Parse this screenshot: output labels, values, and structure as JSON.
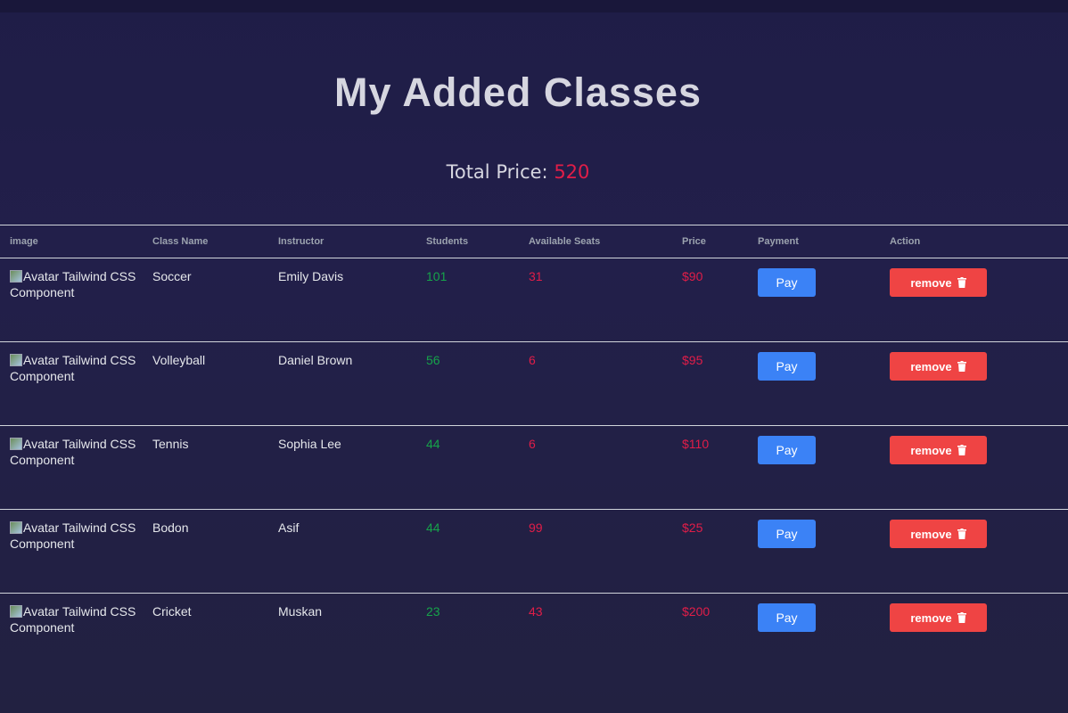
{
  "page": {
    "title": "My Added Classes",
    "total_label": "Total Price:",
    "total_value": "520"
  },
  "table": {
    "headers": [
      "image",
      "Class Name",
      "Instructor",
      "Students",
      "Available Seats",
      "Price",
      "Payment",
      "Action"
    ],
    "image_alt": "Avatar Tailwind CSS Component",
    "pay_label": "Pay",
    "remove_label": "remove",
    "rows": [
      {
        "class_name": "Soccer",
        "instructor": "Emily Davis",
        "students": "101",
        "seats": "31",
        "price": "$90"
      },
      {
        "class_name": "Volleyball",
        "instructor": "Daniel Brown",
        "students": "56",
        "seats": "6",
        "price": "$95"
      },
      {
        "class_name": "Tennis",
        "instructor": "Sophia Lee",
        "students": "44",
        "seats": "6",
        "price": "$110"
      },
      {
        "class_name": "Bodon",
        "instructor": "Asif",
        "students": "44",
        "seats": "99",
        "price": "$25"
      },
      {
        "class_name": "Cricket",
        "instructor": "Muskan",
        "students": "23",
        "seats": "43",
        "price": "$200"
      }
    ]
  },
  "colors": {
    "students": "#16a34a",
    "seats": "#e11d48",
    "price": "#e11d48",
    "pay_button": "#3b82f6",
    "remove_button": "#ef4444"
  },
  "icons": {
    "remove": "trash-icon",
    "image": "broken-image-icon"
  }
}
